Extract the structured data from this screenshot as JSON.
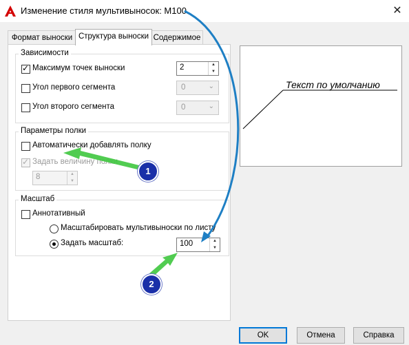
{
  "window": {
    "title": "Изменение стиля мультивыносок: M100",
    "app_icon": "autocad-logo-icon",
    "close_glyph": "✕"
  },
  "tabs": [
    {
      "label": "Формат выноски",
      "active": false
    },
    {
      "label": "Структура выноски",
      "active": true
    },
    {
      "label": "Содержимое",
      "active": false
    }
  ],
  "constraints": {
    "legend": "Зависимости",
    "max_points": {
      "label": "Максимум точек выноски",
      "checked": true,
      "value": "2"
    },
    "first_segment": {
      "label": "Угол первого сегмента",
      "checked": false,
      "value": "0"
    },
    "second_segment": {
      "label": "Угол второго сегмента",
      "checked": false,
      "value": "0"
    }
  },
  "landing": {
    "legend": "Параметры полки",
    "auto_include": {
      "label": "Автоматически добавлять полку",
      "checked": false
    },
    "set_distance": {
      "label": "Задать величину полки",
      "checked": true,
      "disabled": true
    },
    "distance_value": "8"
  },
  "scale": {
    "legend": "Масштаб",
    "annotative": {
      "label": "Аннотативный",
      "checked": false
    },
    "scale_to_layout": {
      "label": "Масштабировать мультивыноски по листу",
      "selected": false
    },
    "specify_scale": {
      "label": "Задать масштаб:",
      "selected": true,
      "value": "100"
    }
  },
  "preview": {
    "text": "Текст по умолчанию"
  },
  "buttons": {
    "ok": "OK",
    "cancel": "Отмена",
    "help": "Справка"
  },
  "annotations": [
    {
      "number": "1",
      "color": "#1a2fa8"
    },
    {
      "number": "2",
      "color": "#1a2fa8"
    }
  ],
  "colors": {
    "accent": "#0078d7",
    "arrow_green": "#3ec63e",
    "arrow_blue": "#1e7fc4",
    "badge": "#1a2fa8"
  }
}
